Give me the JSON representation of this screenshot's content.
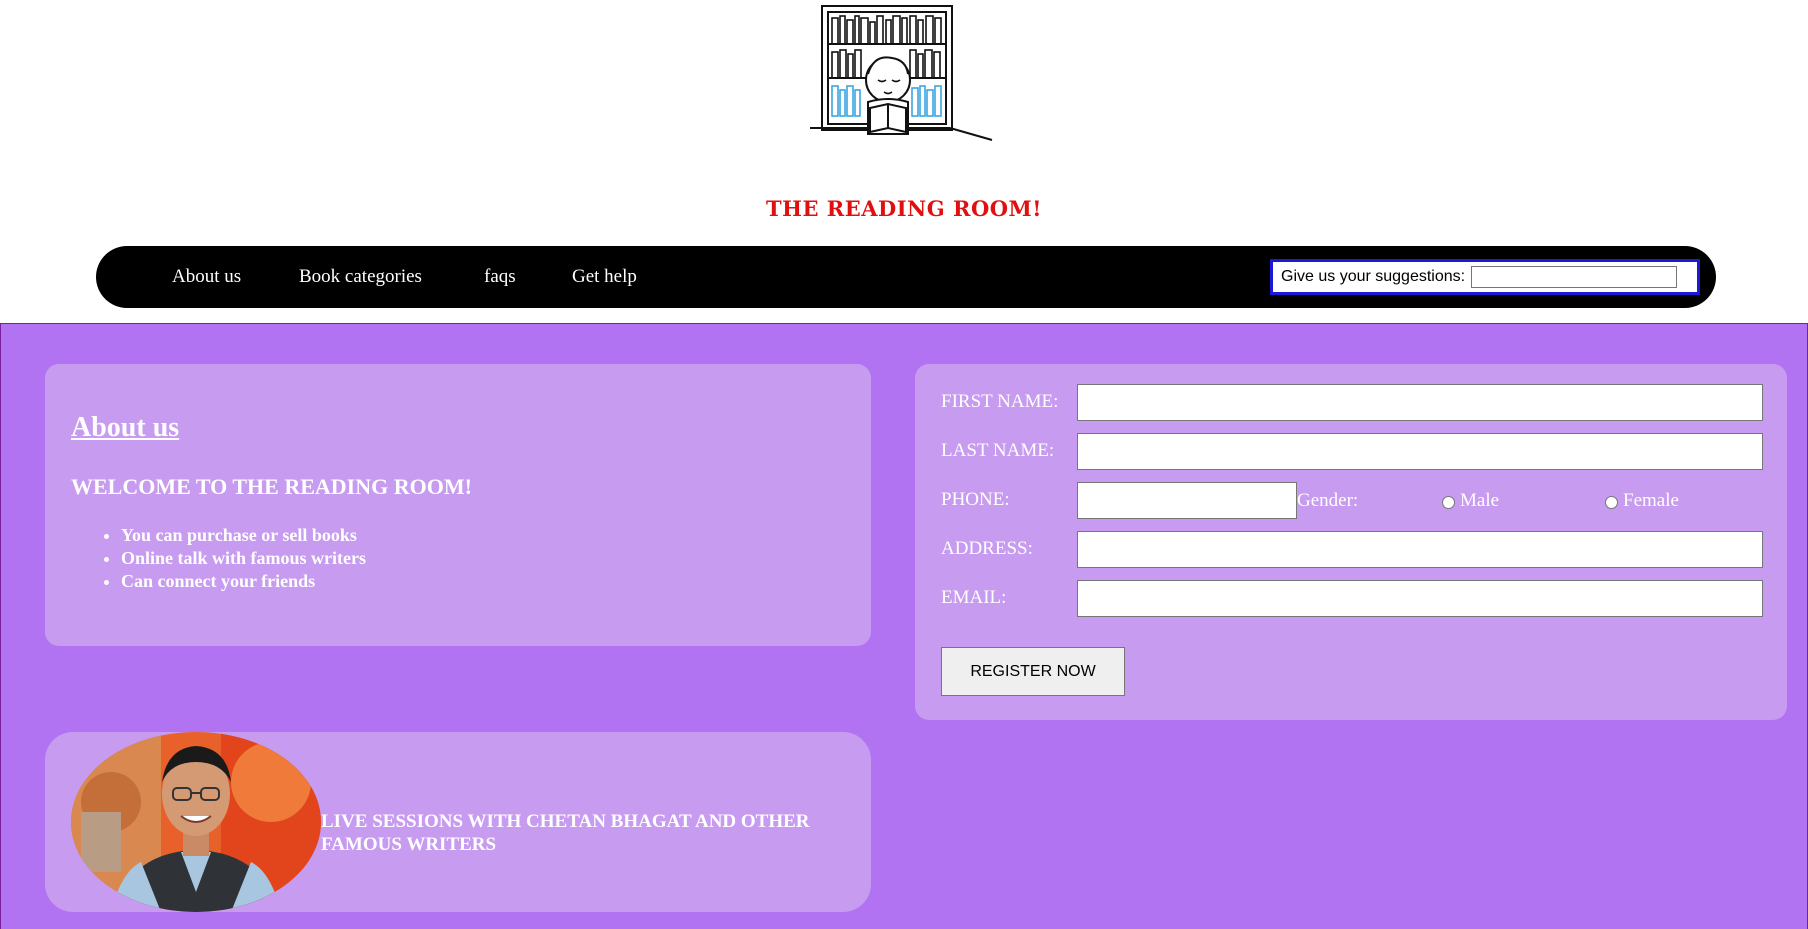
{
  "header": {
    "logo_icon": "boy-reading-bookshelf-icon",
    "site_title": "THE READING ROOM!"
  },
  "nav": {
    "items": [
      {
        "label": "About us"
      },
      {
        "label": "Book categories"
      },
      {
        "label": "faqs"
      },
      {
        "label": "Get help"
      }
    ],
    "suggestion_label": "Give us your suggestions:",
    "suggestion_value": ""
  },
  "about": {
    "heading": "About us",
    "welcome": "WELCOME TO THE READING ROOM!",
    "features": [
      "You can purchase or sell books",
      "Online talk with famous writers",
      "Can connect your friends"
    ]
  },
  "live": {
    "portrait_icon": "writer-portrait-photo",
    "text": "LIVE SESSIONS WITH CHETAN BHAGAT AND OTHER FAMOUS WRITERS"
  },
  "form": {
    "first_name_label": "FIRST NAME:",
    "first_name_value": "",
    "last_name_label": "LAST NAME:",
    "last_name_value": "",
    "phone_label": "PHONE:",
    "phone_value": "",
    "gender_label": "Gender:",
    "gender_options": [
      "Male",
      "Female"
    ],
    "address_label": "ADDRESS:",
    "address_value": "",
    "email_label": "EMAIL:",
    "email_value": "",
    "register_label": "REGISTER NOW"
  },
  "colors": {
    "title": "#e01010",
    "navbar": "#000000",
    "main_bg": "#b273f2",
    "panel_bg": "#c79bef",
    "suggest_border": "#1a1ad6"
  }
}
